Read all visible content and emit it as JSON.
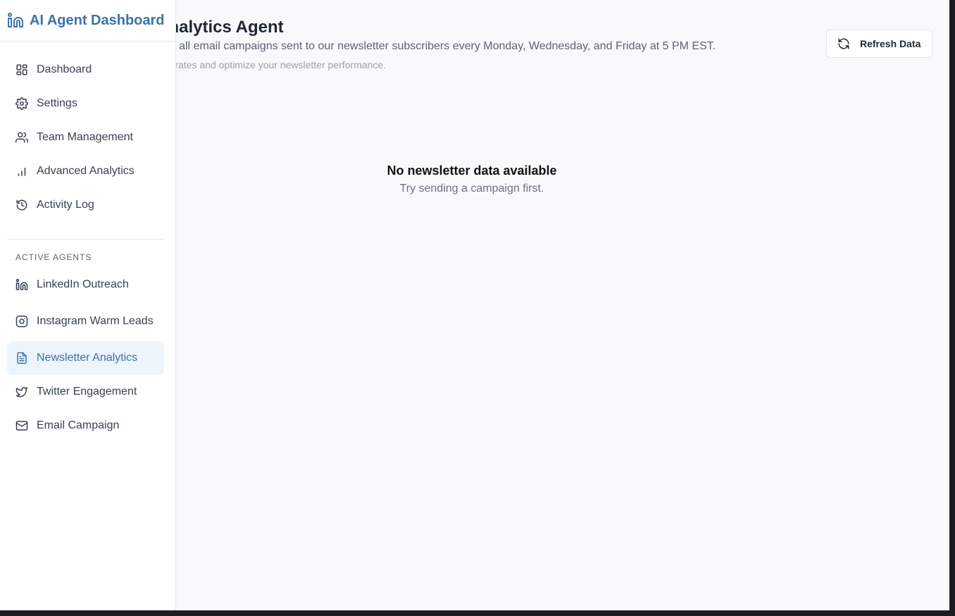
{
  "brand": {
    "name": "AI Agent Dashboard",
    "icon": "linkedin-icon",
    "color": "#3b73a8"
  },
  "nav": [
    {
      "label": "Dashboard",
      "icon": "dashboard-icon"
    },
    {
      "label": "Settings",
      "icon": "gear-icon"
    },
    {
      "label": "Team Management",
      "icon": "users-icon"
    },
    {
      "label": "Advanced Analytics",
      "icon": "bar-chart-icon"
    },
    {
      "label": "Activity Log",
      "icon": "history-icon"
    }
  ],
  "agents_section": {
    "label": "ACTIVE AGENTS",
    "items": [
      {
        "label": "LinkedIn Outreach",
        "icon": "linkedin-icon"
      },
      {
        "label": "Instagram Warm Leads",
        "icon": "instagram-icon"
      },
      {
        "label": "Newsletter Analytics",
        "icon": "document-icon",
        "active": true
      },
      {
        "label": "Twitter Engagement",
        "icon": "twitter-icon"
      },
      {
        "label": "Email Campaign",
        "icon": "mail-icon"
      }
    ]
  },
  "header": {
    "title": "Newsletter Analytics Agent",
    "description": "Detailed analytics on all email campaigns sent to our newsletter subscribers every Monday, Wednesday, and Friday at 5 PM EST.",
    "subtext": "Track open rates, click rates and optimize your newsletter performance.",
    "refresh_label": "Refresh Data"
  },
  "empty_state": {
    "title": "No newsletter data available",
    "subtitle": "Try sending a campaign first."
  }
}
